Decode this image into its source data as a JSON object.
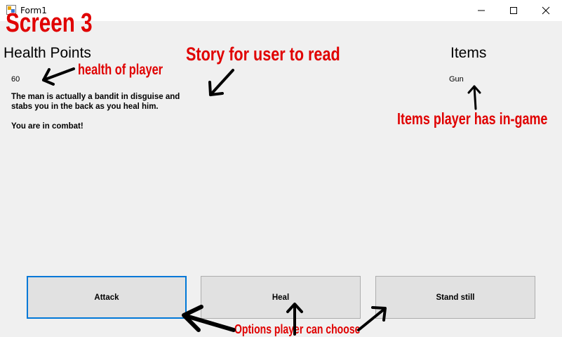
{
  "window": {
    "title": "Form1"
  },
  "labels": {
    "health_heading": "Health Points",
    "health_value": "60",
    "items_heading": "Items",
    "items_value": "Gun"
  },
  "story": {
    "line1": "The man is actually a bandit in disguise and",
    "line2": "stabs you in the back as you heal him.",
    "line3": "You are in combat!"
  },
  "buttons": {
    "attack": "Attack",
    "heal": "Heal",
    "stand_still": "Stand still"
  },
  "annotations": {
    "screen_label": "Screen 3",
    "health_note": "health of player",
    "story_note": "Story for user to read",
    "items_note": "Items player has in-game",
    "options_note": "Options player can choose",
    "color": "#e00000"
  }
}
